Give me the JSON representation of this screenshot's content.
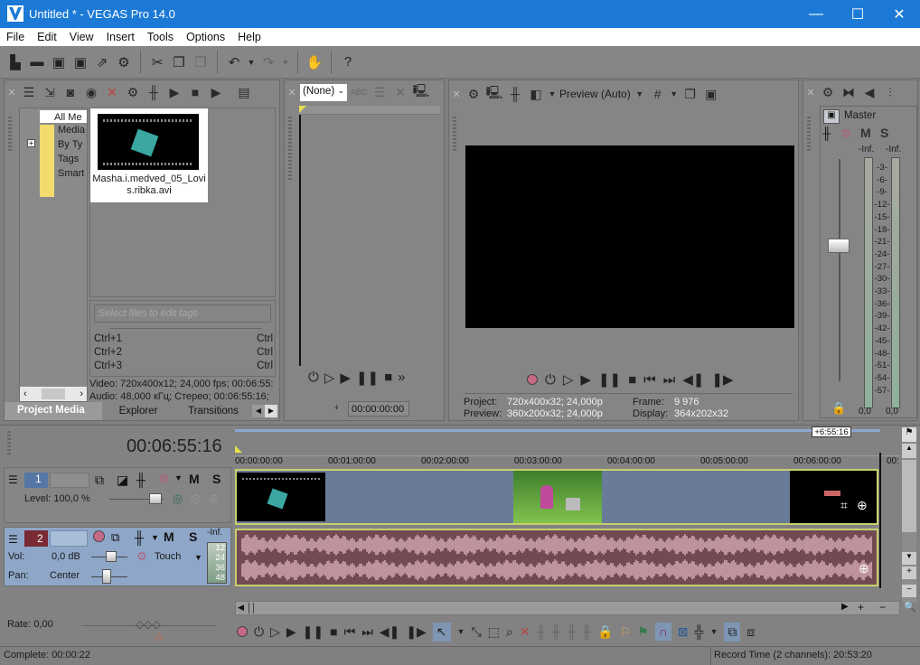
{
  "window": {
    "title": "Untitled * - VEGAS Pro 14.0",
    "minimize": "—",
    "maximize": "☐",
    "close": "✕"
  },
  "menu": [
    "File",
    "Edit",
    "View",
    "Insert",
    "Tools",
    "Options",
    "Help"
  ],
  "toolbar": {
    "icons": [
      "new-icon",
      "open-icon",
      "save-icon",
      "save-as-icon",
      "render-icon",
      "properties-icon",
      "cut-icon",
      "copy-icon",
      "paste-icon",
      "undo-icon",
      "redo-icon",
      "enable-snapping-hand-icon",
      "whats-this-help-icon"
    ]
  },
  "project_media": {
    "tree": [
      "All Me",
      "Media",
      "By Ty",
      "Tags",
      "Smart"
    ],
    "file": {
      "name": "Masha.i.medved_05_Lovis.ribka.avi"
    },
    "tags_placeholder": "Select files to edit tags",
    "shortcuts": [
      [
        "Ctrl+1",
        "Ctrl"
      ],
      [
        "Ctrl+2",
        "Ctrl"
      ],
      [
        "Ctrl+3",
        "Ctrl"
      ]
    ],
    "video_info": "Video: 720x400x12; 24,000 fps; 00:06:55:",
    "audio_info": "Audio: 48,000 кГц; Стерео; 00:06:55:16;",
    "tabs": [
      "Project Media",
      "Explorer",
      "Transitions"
    ]
  },
  "trimmer": {
    "select": "(None)",
    "timecode": "00:00:00:00"
  },
  "preview": {
    "mode": "Preview (Auto)",
    "project_label": "Project:",
    "project_value": "720x400x32; 24,000p",
    "preview_label": "Preview:",
    "preview_value": "360x200x32; 24,000p",
    "frame_label": "Frame:",
    "frame_value": "9 976",
    "display_label": "Display:",
    "display_value": "364x202x32"
  },
  "master": {
    "label": "Master",
    "m": "M",
    "s": "S",
    "inf_left": "-Inf.",
    "inf_right": "-Inf.",
    "scale": [
      "3",
      "6",
      "9",
      "12",
      "15",
      "18",
      "21",
      "24",
      "27",
      "30",
      "33",
      "36",
      "39",
      "42",
      "45",
      "48",
      "51",
      "54",
      "57"
    ],
    "val_left": "0,0",
    "val_right": "0,0"
  },
  "timeline": {
    "timecode": "00:06:55:16",
    "length_badge": "+6:55:16",
    "ruler": [
      "00:00:00:00",
      "00:01:00:00",
      "00:02:00:00",
      "00:03:00:00",
      "00:04:00:00",
      "00:05:00:00",
      "00:06:00:00",
      "00:"
    ],
    "track1": {
      "number": "1",
      "m": "M",
      "s": "S",
      "level": "Level: 100,0 %"
    },
    "track2": {
      "number": "2",
      "m": "M",
      "s": "S",
      "inf": "-Inf.",
      "vol_label": "Vol:",
      "vol": "0,0 dB",
      "pan_label": "Pan:",
      "pan": "Center",
      "automation": "Touch",
      "meter": [
        "12",
        "24",
        "36",
        "48"
      ]
    },
    "rate": "Rate: 0,00"
  },
  "status": {
    "complete": "Complete: 00:00:22",
    "record_time": "Record Time (2 channels): 20:53:20"
  },
  "colors": {
    "titlebar": "#1c7ad6",
    "audio_track": "#724a54",
    "video_track": "#6a7b9a",
    "waveform": "#d2a6ae"
  }
}
